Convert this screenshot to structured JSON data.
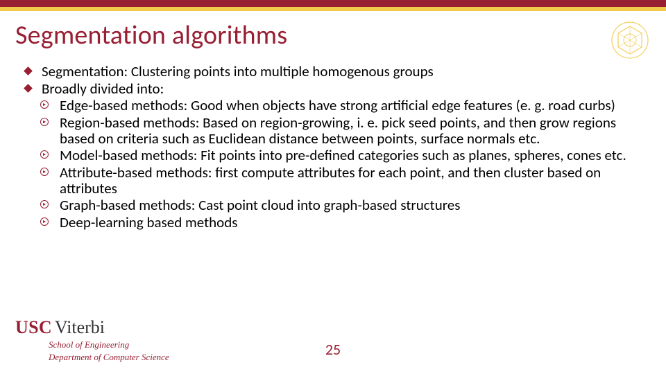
{
  "title": "Segmentation algorithms",
  "bullets": [
    {
      "text": "Segmentation: Clustering points into multiple homogenous groups"
    },
    {
      "text": "Broadly divided into:",
      "children": [
        "Edge-based methods: Good when objects have strong artificial edge features (e. g. road curbs)",
        "Region-based methods: Based on region-growing, i. e. pick seed points, and then grow regions based on criteria such as Euclidean distance between points, surface normals etc.",
        "Model-based methods: Fit points into pre-defined categories such as planes, spheres, cones etc.",
        "Attribute-based methods: first compute attributes for each point, and then cluster based on attributes",
        "Graph-based methods: Cast point cloud into graph-based structures",
        "Deep-learning based methods"
      ]
    }
  ],
  "footer": {
    "org1": "USC",
    "org2": "Viterbi",
    "line1": "School of Engineering",
    "line2": "Department of Computer Science"
  },
  "page_number": "25"
}
